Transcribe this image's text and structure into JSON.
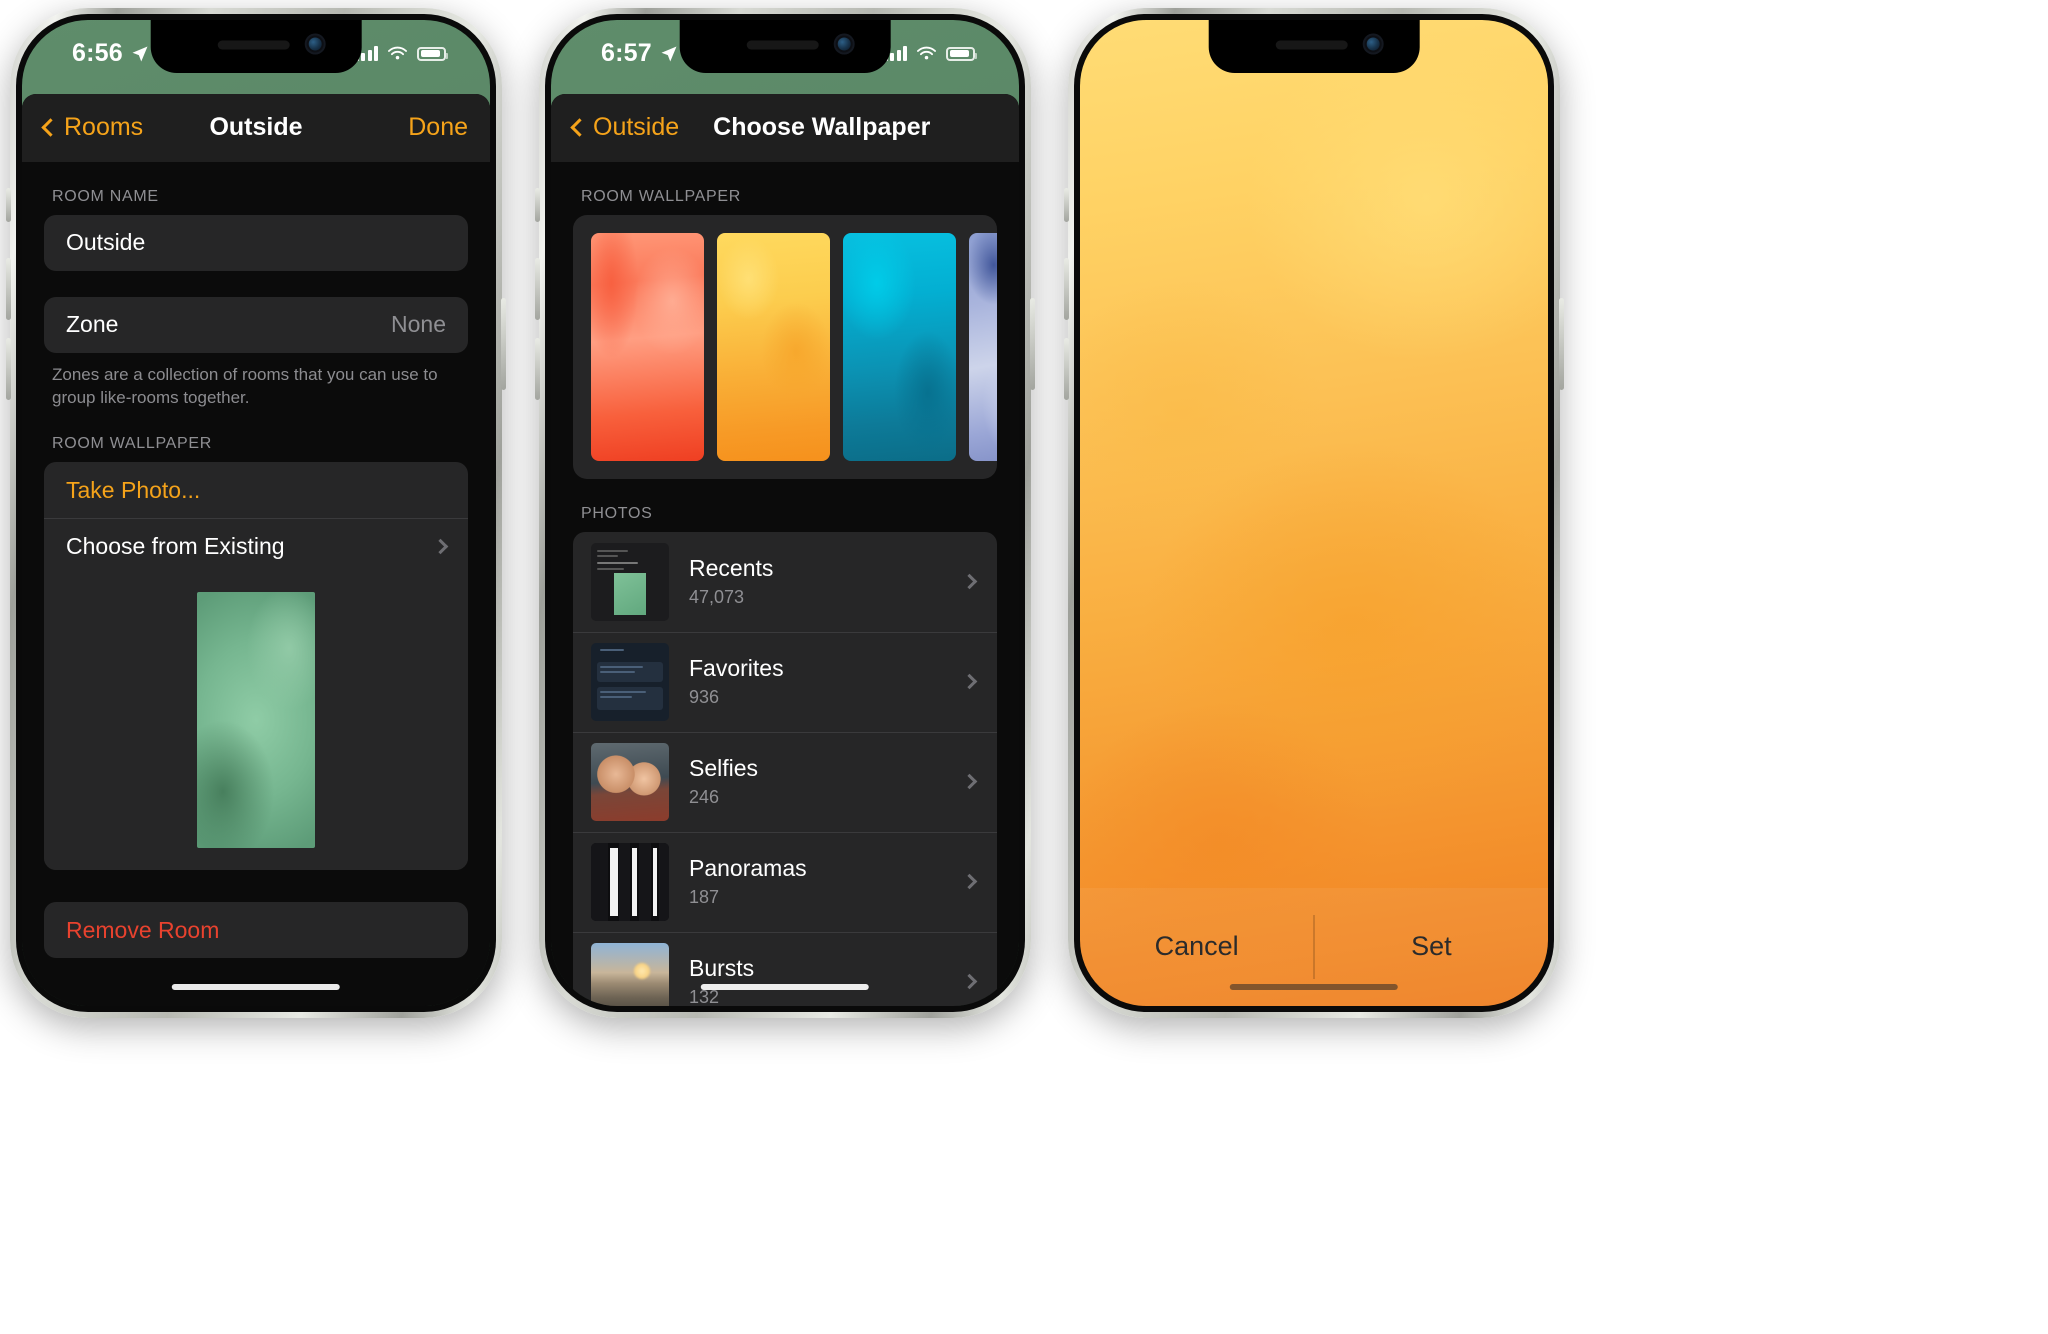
{
  "phone1": {
    "status": {
      "time": "6:56",
      "location_icon": "location-arrow-icon"
    },
    "nav": {
      "back_label": "Rooms",
      "title": "Outside",
      "done_label": "Done"
    },
    "room_name": {
      "header": "ROOM NAME",
      "value": "Outside"
    },
    "zone": {
      "label": "Zone",
      "value": "None",
      "footnote": "Zones are a collection of rooms that you can use to group like-rooms together."
    },
    "wallpaper": {
      "header": "ROOM WALLPAPER",
      "take_photo": "Take Photo...",
      "choose_existing": "Choose from Existing"
    },
    "remove": {
      "label": "Remove Room"
    }
  },
  "phone2": {
    "status": {
      "time": "6:57",
      "location_icon": "location-arrow-icon"
    },
    "nav": {
      "back_label": "Outside",
      "title": "Choose Wallpaper"
    },
    "wallpaper": {
      "header": "ROOM WALLPAPER",
      "swatches": [
        {
          "name": "coral",
          "color": "#fb7a5b"
        },
        {
          "name": "yellow",
          "color": "#f9ae36"
        },
        {
          "name": "teal",
          "color": "#03afd2"
        },
        {
          "name": "blue",
          "color": "#aab5dd"
        }
      ]
    },
    "photos": {
      "header": "PHOTOS",
      "albums": [
        {
          "name": "Recents",
          "count": "47,073",
          "thumb": "screenshot-thumbnail"
        },
        {
          "name": "Favorites",
          "count": "936",
          "thumb": "message-thread-thumbnail"
        },
        {
          "name": "Selfies",
          "count": "246",
          "thumb": "two-people-selfie-thumbnail"
        },
        {
          "name": "Panoramas",
          "count": "187",
          "thumb": "panorama-building-thumbnail"
        },
        {
          "name": "Bursts",
          "count": "132",
          "thumb": "beach-sunset-thumbnail"
        }
      ]
    }
  },
  "phone3": {
    "wallpaper_name": "yellow-orange-gradient",
    "actions": {
      "cancel": "Cancel",
      "set": "Set"
    }
  }
}
